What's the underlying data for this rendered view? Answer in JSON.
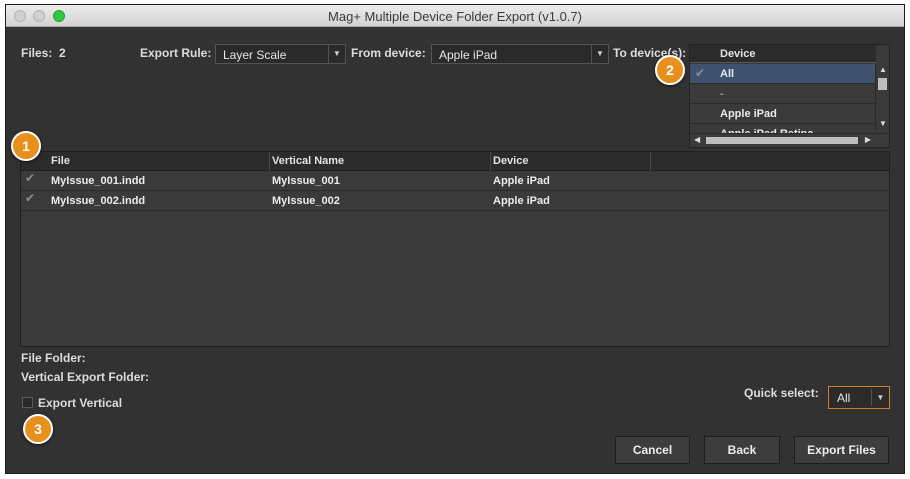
{
  "window": {
    "title": "Mag+ Multiple Device Folder Export (v1.0.7)"
  },
  "files": {
    "label": "Files:",
    "count": "2"
  },
  "export_rule": {
    "label": "Export Rule:",
    "value": "Layer Scale"
  },
  "from_device": {
    "label": "From device:",
    "value": "Apple iPad"
  },
  "to_devices": {
    "label": "To device(s):",
    "header": "Device",
    "items": [
      {
        "label": "All",
        "checked": true,
        "selected": true
      },
      {
        "label": "-",
        "checked": false,
        "selected": false
      },
      {
        "label": "Apple iPad",
        "checked": false,
        "selected": false
      },
      {
        "label": "Apple iPad Retina",
        "checked": false,
        "selected": false
      }
    ]
  },
  "table": {
    "columns": [
      "File",
      "Vertical Name",
      "Device"
    ],
    "rows": [
      {
        "file": "MyIssue_001.indd",
        "vertical_name": "MyIssue_001",
        "device": "Apple iPad",
        "checked": true
      },
      {
        "file": "MyIssue_002.indd",
        "vertical_name": "MyIssue_002",
        "device": "Apple iPad",
        "checked": true
      }
    ]
  },
  "folders": {
    "file_folder_label": "File Folder:",
    "vertical_export_label": "Vertical Export Folder:"
  },
  "export_vertical": {
    "label": "Export Vertical",
    "checked": false
  },
  "quick_select": {
    "label": "Quick select:",
    "value": "All"
  },
  "buttons": {
    "cancel": "Cancel",
    "back": "Back",
    "export": "Export Files"
  },
  "callouts": [
    "1",
    "2",
    "3"
  ],
  "colors": {
    "accent": "#e8901c",
    "window_bg": "#323232",
    "selection": "#3e5270"
  }
}
